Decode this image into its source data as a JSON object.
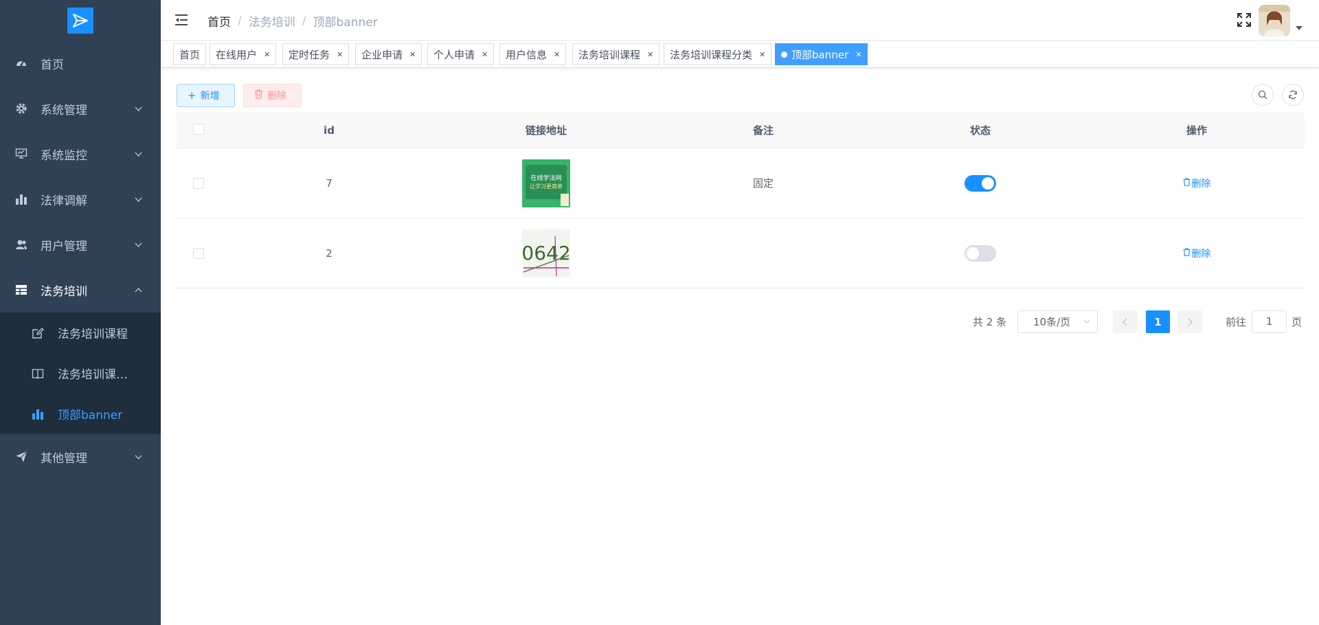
{
  "sidebar": {
    "logo_icon": "paper-plane-logo-icon",
    "items": [
      {
        "label": "首页",
        "icon": "dashboard-icon"
      },
      {
        "label": "系统管理",
        "icon": "gear-icon"
      },
      {
        "label": "系统监控",
        "icon": "monitor-icon"
      },
      {
        "label": "法律调解",
        "icon": "bar-chart-icon"
      },
      {
        "label": "用户管理",
        "icon": "users-icon"
      },
      {
        "label": "法务培训",
        "icon": "table-icon"
      },
      {
        "label": "其他管理",
        "icon": "send-icon"
      }
    ],
    "submenu": [
      {
        "label": "法务培训课程",
        "icon": "edit-icon"
      },
      {
        "label": "法务培训课…",
        "icon": "book-icon"
      },
      {
        "label": "顶部banner",
        "icon": "bar-chart-icon",
        "active": true
      }
    ]
  },
  "header": {
    "breadcrumb": [
      "首页",
      "法务培训",
      "顶部banner"
    ],
    "separator": "/"
  },
  "tags": [
    {
      "label": "首页"
    },
    {
      "label": "在线用户"
    },
    {
      "label": "定时任务"
    },
    {
      "label": "企业申请"
    },
    {
      "label": "个人申请"
    },
    {
      "label": "用户信息"
    },
    {
      "label": "法务培训课程"
    },
    {
      "label": "法务培训课程分类"
    },
    {
      "label": "顶部banner",
      "active": true
    }
  ],
  "toolbar": {
    "add_label": "新增",
    "delete_label": "删除"
  },
  "table": {
    "headers": [
      "id",
      "链接地址",
      "备注",
      "状态",
      "操作"
    ],
    "rows": [
      {
        "id": "7",
        "image": "banner-thumbnail-green",
        "thumb_text": "在线学法网\n让学习更简单",
        "remark": "固定",
        "status_on": true,
        "action": "删除"
      },
      {
        "id": "2",
        "image": "captcha-thumbnail",
        "thumb_text": "0642",
        "remark": "",
        "status_on": false,
        "action": "删除"
      }
    ]
  },
  "pagination": {
    "total_text": "共 2 条",
    "page_size": "10条/页",
    "current_page": "1",
    "goto_label": "前往",
    "goto_value": "1",
    "page_suffix": "页"
  },
  "colors": {
    "sidebar_bg": "#304156",
    "submenu_bg": "#1f2d3d",
    "primary": "#1890ff",
    "tag_active": "#409eff"
  }
}
